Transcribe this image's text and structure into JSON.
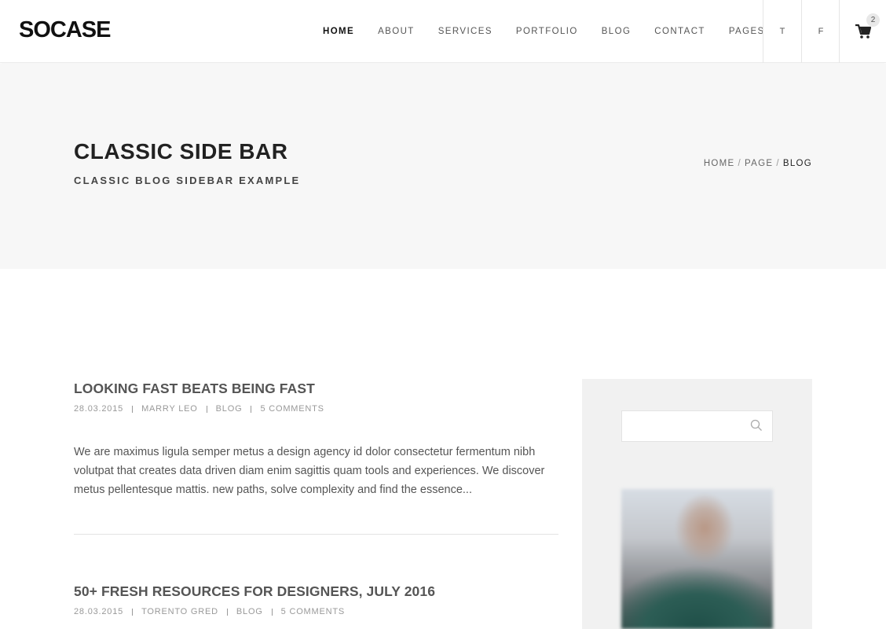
{
  "logo": "SOCASE",
  "nav": {
    "items": [
      "HOME",
      "ABOUT",
      "SERVICES",
      "PORTFOLIO",
      "BLOG",
      "CONTACT",
      "PAGES"
    ],
    "active": "HOME"
  },
  "social": {
    "twitter_label": "T",
    "facebook_label": "F"
  },
  "cart": {
    "count": "2",
    "icon": "cart-icon"
  },
  "page_header": {
    "title": "CLASSIC SIDE BAR",
    "subtitle": "CLASSIC BLOG SIDEBAR EXAMPLE",
    "breadcrumb": [
      "HOME",
      "PAGE",
      "BLOG"
    ],
    "breadcrumb_sep": "/"
  },
  "posts": [
    {
      "title": "LOOKING FAST BEATS BEING FAST",
      "date": "28.03.2015",
      "author": "MARRY LEO",
      "category": "BLOG",
      "comments": "5 COMMENTS",
      "excerpt": "We are maximus ligula semper metus a design agency id dolor consectetur fermentum nibh volutpat that creates data driven diam enim sagittis quam tools and experiences. We discover metus pellentesque mattis. new paths, solve complexity and find the essence..."
    },
    {
      "title": "50+ FRESH RESOURCES FOR DESIGNERS, JULY 2016",
      "date": "28.03.2015",
      "author": "TORENTO GRED",
      "category": "BLOG",
      "comments": "5 COMMENTS"
    }
  ],
  "sidebar": {
    "search_placeholder": "",
    "search_icon": "search-icon",
    "widget_image": "blurred-portrait-photo"
  },
  "colors": {
    "accent": "#222222",
    "title_band_bg": "#f7f7f7",
    "sidebar_bg": "#f1f1f1"
  }
}
